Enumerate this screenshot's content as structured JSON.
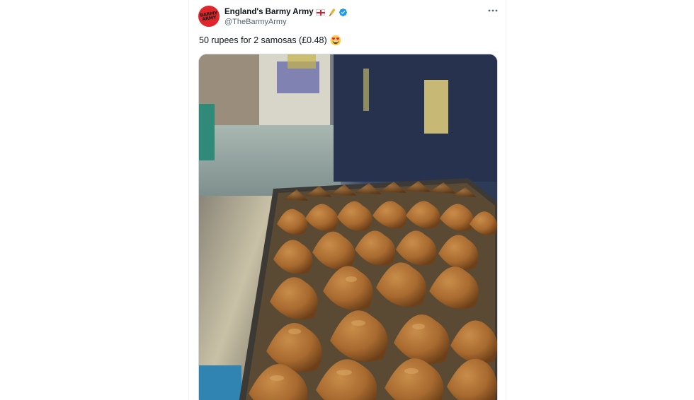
{
  "tweet": {
    "author": {
      "display_name": "England's Barmy Army",
      "handle": "@TheBarmyArmy",
      "avatar_text": "BARMY ARMY",
      "avatar_color": "#e0262b",
      "name_icons": [
        "england-flag-icon",
        "cricket-bat-icon",
        "verified-badge-icon"
      ],
      "verified_color": "#1d9bf0"
    },
    "text": "50 rupees for 2 samosas (£0.48)",
    "text_emoji": "heart-eyes-emoji-icon",
    "more_icon": "more-options-icon",
    "media": {
      "kind": "photo",
      "subject": "samosas-on-tray"
    }
  },
  "colors": {
    "text_primary": "#0f1419",
    "text_secondary": "#536471",
    "border": "#cfd9de"
  }
}
